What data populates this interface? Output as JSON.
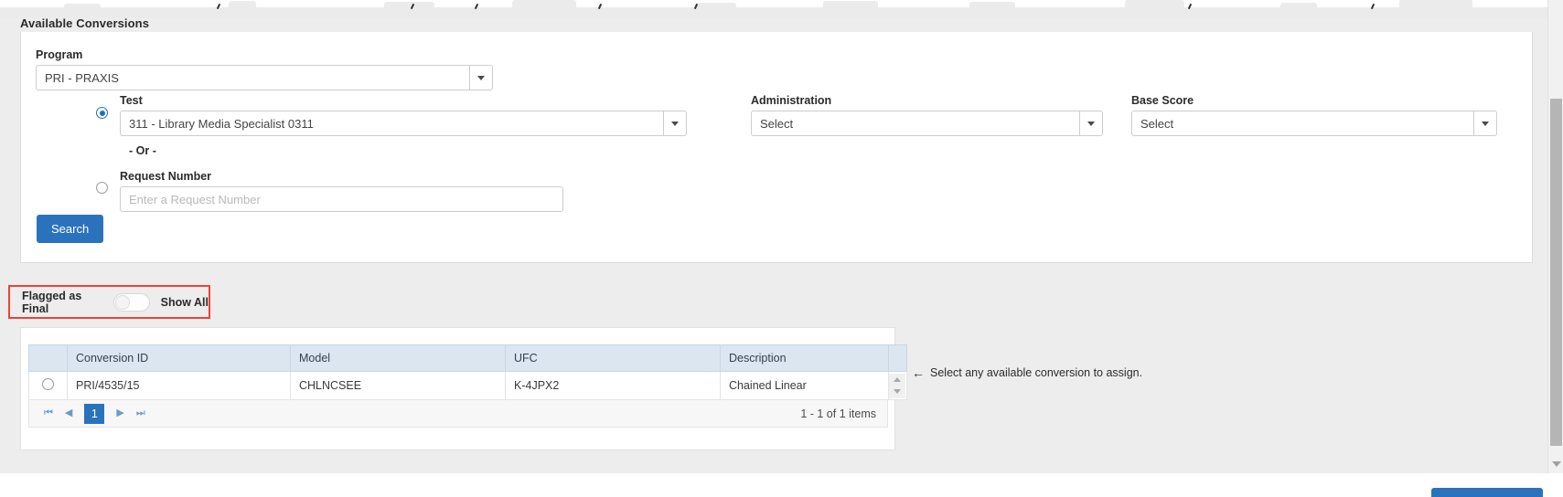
{
  "panel": {
    "heading": "Available Conversions"
  },
  "form": {
    "program": {
      "label": "Program",
      "value": "PRI - PRAXIS"
    },
    "test": {
      "label": "Test",
      "value": "311 - Library Media Specialist 0311",
      "radio_selected": true
    },
    "administration": {
      "label": "Administration",
      "value": "Select"
    },
    "base_score": {
      "label": "Base Score",
      "value": "Select"
    },
    "or_separator": "- Or -",
    "request_number": {
      "label": "Request Number",
      "value": "",
      "placeholder": "Enter a Request Number",
      "radio_selected": false
    },
    "search_button": "Search"
  },
  "filter_bar": {
    "flagged_label": "Flagged as Final",
    "show_all_label": "Show All",
    "toggle_state": "off",
    "highlight_color": "#f04134"
  },
  "grid": {
    "columns": [
      "Conversion ID",
      "Model",
      "UFC",
      "Description"
    ],
    "rows": [
      {
        "selected": false,
        "conversion_id": "PRI/4535/15",
        "model": "CHLNCSEE",
        "ufc": "K-4JPX2",
        "description": "Chained Linear"
      }
    ],
    "pager": {
      "first_icon": "⏮",
      "prev_icon": "◀",
      "current_page": "1",
      "next_icon": "▶",
      "last_icon": "⏭",
      "info": "1 - 1 of 1 items"
    }
  },
  "hint": {
    "arrow_icon": "←",
    "text": "Select any available conversion to assign."
  },
  "colors": {
    "accent": "#2b72bd",
    "header_row": "#dce6f1",
    "page_bg": "#ededed"
  }
}
